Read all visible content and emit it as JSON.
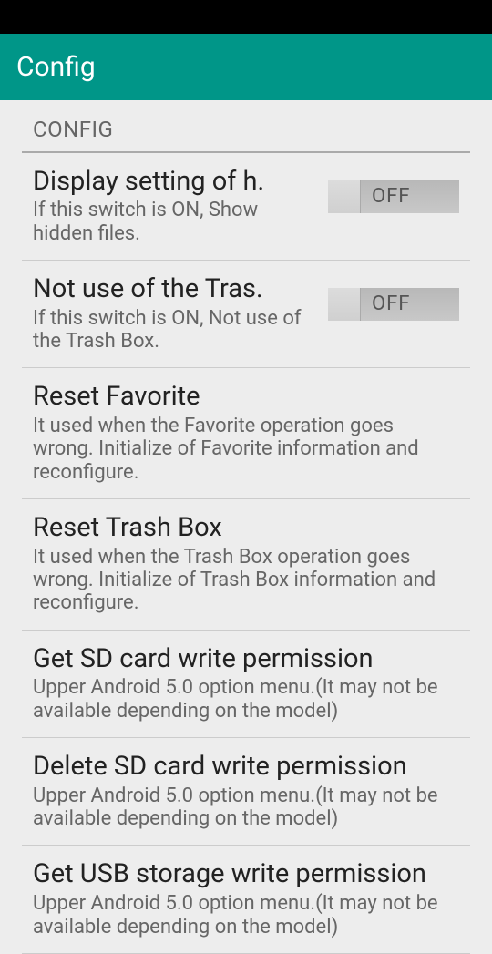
{
  "header": {
    "title": "Config"
  },
  "section": {
    "label": "CONFIG"
  },
  "items": [
    {
      "title": "Display setting of h.",
      "subtitle": "If this switch is ON, Show hidden files.",
      "switch": "OFF"
    },
    {
      "title": "Not use of the Tras.",
      "subtitle": "If this switch is ON, Not use of the Trash Box.",
      "switch": "OFF"
    },
    {
      "title": "Reset Favorite",
      "subtitle": "It used when the Favorite operation goes wrong. Initialize of Favorite information and reconfigure."
    },
    {
      "title": "Reset Trash Box",
      "subtitle": "It used when the Trash Box operation goes wrong. Initialize of Trash Box information and reconfigure."
    },
    {
      "title": "Get SD card write permission",
      "subtitle": "Upper Android 5.0 option menu.(It may not be available depending on the model)"
    },
    {
      "title": "Delete SD card write permission",
      "subtitle": "Upper Android 5.0 option menu.(It may not be available depending on the model)"
    },
    {
      "title": "Get USB storage write permission",
      "subtitle": "Upper Android 5.0 option menu.(It may not be available depending on the model)"
    }
  ]
}
